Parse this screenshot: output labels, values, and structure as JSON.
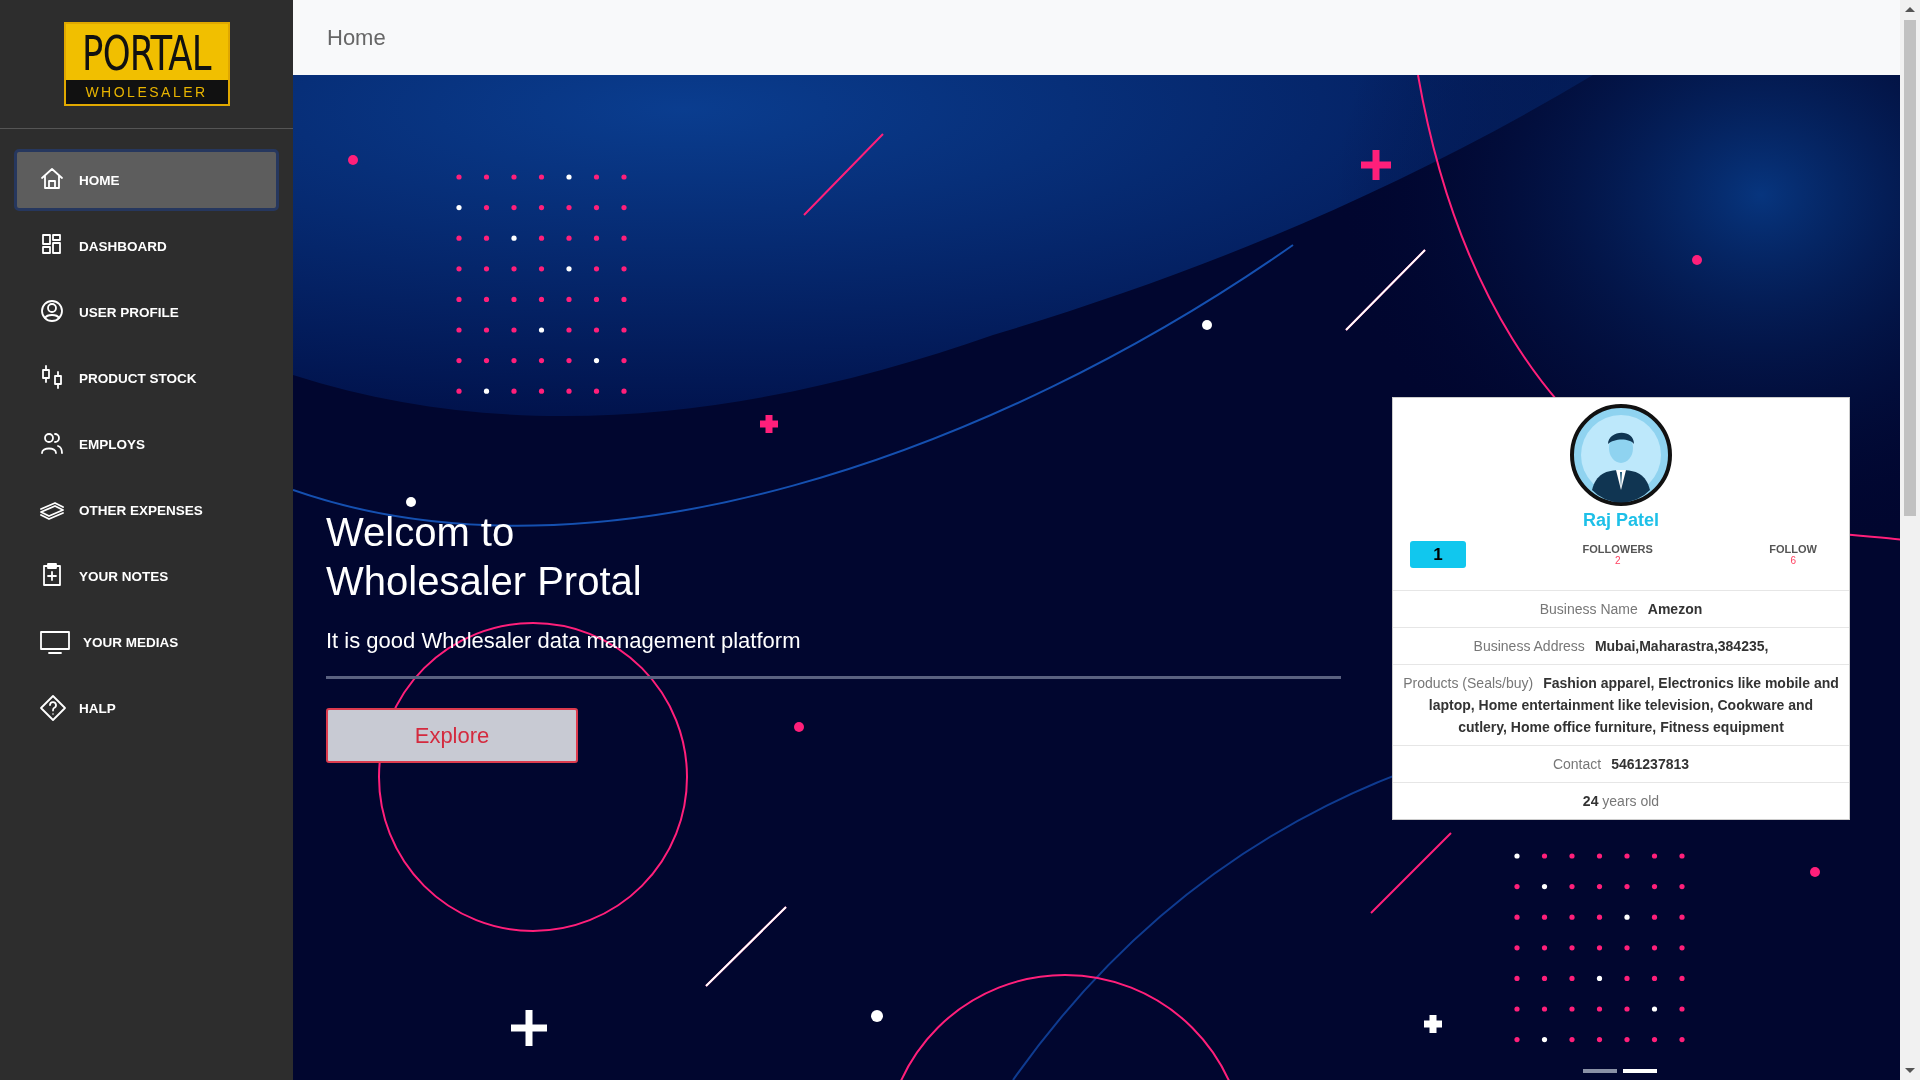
{
  "logo": {
    "title": "PORTAL",
    "subtitle": "WHOLESALER"
  },
  "sidebar": {
    "items": [
      {
        "label": "HOME",
        "selected": true
      },
      {
        "label": "DASHBOARD",
        "selected": false
      },
      {
        "label": "USER PROFILE",
        "selected": false
      },
      {
        "label": "PRODUCT STOCK",
        "selected": false
      },
      {
        "label": "EMPLOYS",
        "selected": false
      },
      {
        "label": "OTHER EXPENSES",
        "selected": false
      },
      {
        "label": "YOUR NOTES",
        "selected": false
      },
      {
        "label": "YOUR MEDIAS",
        "selected": false
      },
      {
        "label": "HALP",
        "selected": false
      }
    ]
  },
  "header": {
    "title": "Home"
  },
  "hero": {
    "title": "Welcom to Wholesaler Protal",
    "subtitle": "It is good Wholesaler data management platform",
    "button": "Explore"
  },
  "profile_card": {
    "name": "Raj Patel",
    "badge": "1",
    "stats": [
      {
        "label": "FOLLOWERS",
        "value": "2"
      },
      {
        "label": "FOLLOW",
        "value": "6"
      }
    ],
    "details": [
      {
        "label": "Business Name",
        "value": "Amezon"
      },
      {
        "label": "Business Address",
        "value": "Mubai,Maharastra,384235,"
      },
      {
        "label": "Products (Seals/buy)",
        "value": "Fashion apparel, Electronics like mobile and laptop, Home entertainment like television, Cookware and cutlery, Home office furniture, Fitness equipment"
      },
      {
        "label": "Contact",
        "value": "5461237813"
      }
    ],
    "age": "**24** years old"
  },
  "carousel": {
    "slides": [
      {
        "selected": false
      },
      {
        "selected": true
      }
    ]
  }
}
